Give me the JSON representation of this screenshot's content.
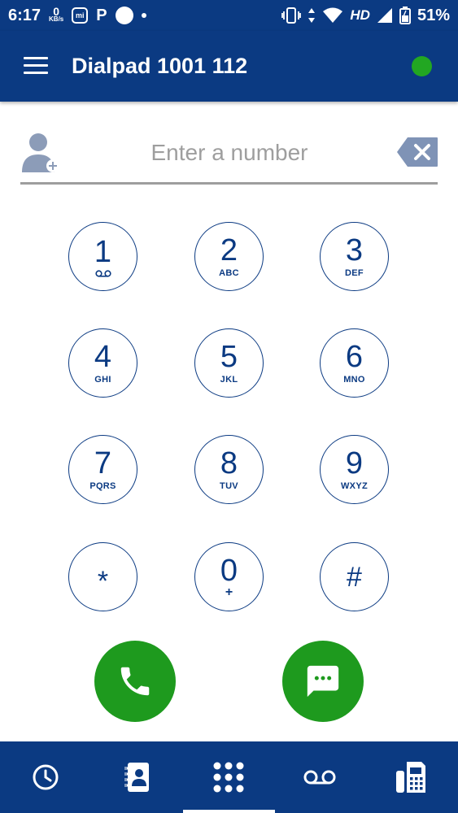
{
  "status_bar": {
    "time": "6:17",
    "net_speed_value": "0",
    "net_speed_unit": "KB/s",
    "app_badge": "mi",
    "p_letter": "P",
    "network": "HD",
    "battery": "51%"
  },
  "app_bar": {
    "title": "Dialpad 1001 112",
    "status_color": "#22a722"
  },
  "number_field": {
    "placeholder": "Enter a number",
    "value": ""
  },
  "keypad": [
    {
      "digit": "1",
      "letters": ""
    },
    {
      "digit": "2",
      "letters": "ABC"
    },
    {
      "digit": "3",
      "letters": "DEF"
    },
    {
      "digit": "4",
      "letters": "GHI"
    },
    {
      "digit": "5",
      "letters": "JKL"
    },
    {
      "digit": "6",
      "letters": "MNO"
    },
    {
      "digit": "7",
      "letters": "PQRS"
    },
    {
      "digit": "8",
      "letters": "TUV"
    },
    {
      "digit": "9",
      "letters": "WXYZ"
    },
    {
      "digit": "*",
      "letters": ""
    },
    {
      "digit": "0",
      "letters": "+"
    },
    {
      "digit": "#",
      "letters": ""
    }
  ],
  "colors": {
    "brand": "#0b3a82",
    "action_green": "#1e9a1e",
    "divider": "#9e9e9e"
  },
  "bottom_nav": {
    "items": [
      {
        "icon": "clock-icon",
        "selected": false
      },
      {
        "icon": "contacts-icon",
        "selected": false
      },
      {
        "icon": "dialpad-icon",
        "selected": true
      },
      {
        "icon": "voicemail-icon",
        "selected": false
      },
      {
        "icon": "fax-icon",
        "selected": false
      }
    ]
  }
}
